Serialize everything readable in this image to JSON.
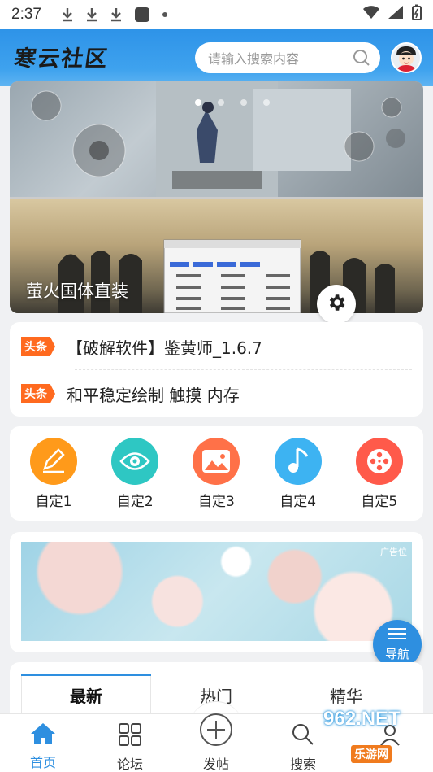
{
  "status_bar": {
    "time": "2:37"
  },
  "header": {
    "logo_text": "寒云社区",
    "search_placeholder": "请输入搜索内容"
  },
  "banner": {
    "title": "萤火国体直装"
  },
  "news": [
    {
      "tag": "头条",
      "text": "【破解软件】鉴黄师_1.6.7"
    },
    {
      "tag": "头条",
      "text": "和平稳定绘制 触摸 内存"
    }
  ],
  "shortcuts": [
    {
      "label": "自定1",
      "icon": "edit-icon",
      "color": "#ff9a1a"
    },
    {
      "label": "自定2",
      "icon": "eye-icon",
      "color": "#2ec7c3"
    },
    {
      "label": "自定3",
      "icon": "image-icon",
      "color": "#ff7148"
    },
    {
      "label": "自定4",
      "icon": "music-icon",
      "color": "#3db3f2"
    },
    {
      "label": "自定5",
      "icon": "film-icon",
      "color": "#ff5a4a"
    }
  ],
  "ad": {
    "tag": "广告位"
  },
  "nav_button": {
    "label": "导航"
  },
  "tabs": [
    "最新",
    "热门",
    "精华"
  ],
  "bottom_nav": [
    {
      "label": "首页",
      "icon": "home-icon",
      "active": true
    },
    {
      "label": "论坛",
      "icon": "grid-icon",
      "active": false
    },
    {
      "label": "发帖",
      "icon": "plus-icon",
      "active": false
    },
    {
      "label": "搜索",
      "icon": "search-icon",
      "active": false
    },
    {
      "label": "",
      "icon": "user-icon",
      "active": false
    }
  ],
  "watermark": {
    "text": "962.NET",
    "sub": "乐游网"
  },
  "colors": {
    "accent": "#2e8fe0",
    "tag_orange": "#ff6a1f"
  }
}
